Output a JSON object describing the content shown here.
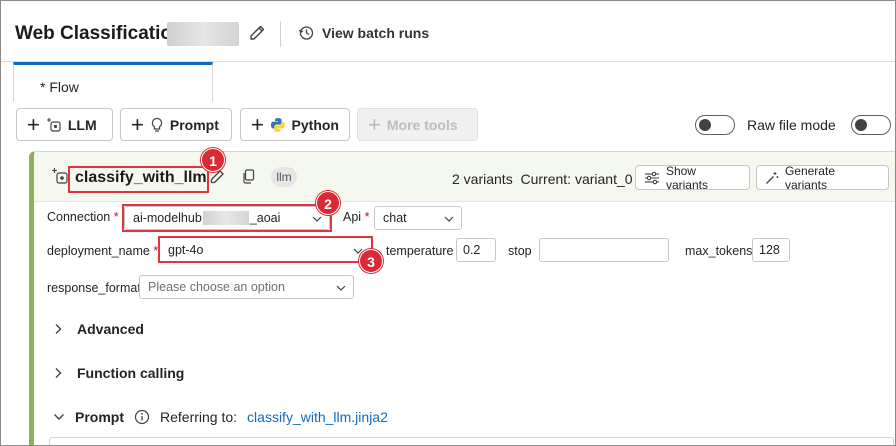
{
  "header": {
    "title": "Web Classification-",
    "view_batch_runs": "View batch runs"
  },
  "tabs": [
    {
      "label": "* Flow",
      "active": true
    }
  ],
  "toolbar": {
    "llm": "LLM",
    "prompt": "Prompt",
    "python": "Python",
    "more_tools": "More tools",
    "raw_file_mode": "Raw file mode"
  },
  "node": {
    "name": "classify_with_llm",
    "badge": "llm",
    "variants_text": "2 variants",
    "current_text": "Current: variant_0",
    "show_variants": "Show variants",
    "generate_variants": "Generate variants",
    "connection_label": "Connection",
    "connection_prefix": "ai-modelhub",
    "connection_suffix": "_aoai",
    "api_label": "Api",
    "api_value": "chat",
    "deployment_label": "deployment_name",
    "deployment_value": "gpt-4o",
    "temperature_label": "temperature",
    "temperature_value": "0.2",
    "stop_label": "stop",
    "stop_value": "",
    "max_tokens_label": "max_tokens",
    "max_tokens_value": "128",
    "response_format_label": "response_format",
    "response_format_placeholder": "Please choose an option",
    "required_mark": "*"
  },
  "sections": {
    "advanced": "Advanced",
    "function_calling": "Function calling",
    "prompt": "Prompt",
    "referring_to": "Referring to:",
    "prompt_file": "classify_with_llm.jinja2"
  },
  "callouts": [
    "1",
    "2",
    "3"
  ],
  "colors": {
    "accent": "#0f6cbd",
    "highlight": "#e0343f",
    "node_border": "#8fb15a",
    "link": "#0f6cbd"
  }
}
